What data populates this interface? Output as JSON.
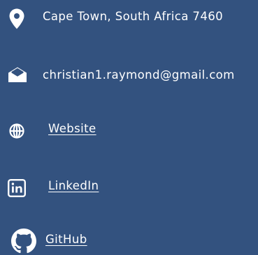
{
  "contact": {
    "address": "Cape Town, South Africa 7460",
    "email": "christian1.raymond@gmail.com",
    "website_label": "Website",
    "linkedin_label": "LinkedIn",
    "github_label": "GitHub"
  },
  "icons": {
    "address": "location-pin-icon",
    "email": "envelope-open-icon",
    "website": "globe-icon",
    "linkedin": "linkedin-icon",
    "github": "github-icon"
  },
  "colors": {
    "background": "#33527f",
    "foreground": "#ffffff"
  }
}
